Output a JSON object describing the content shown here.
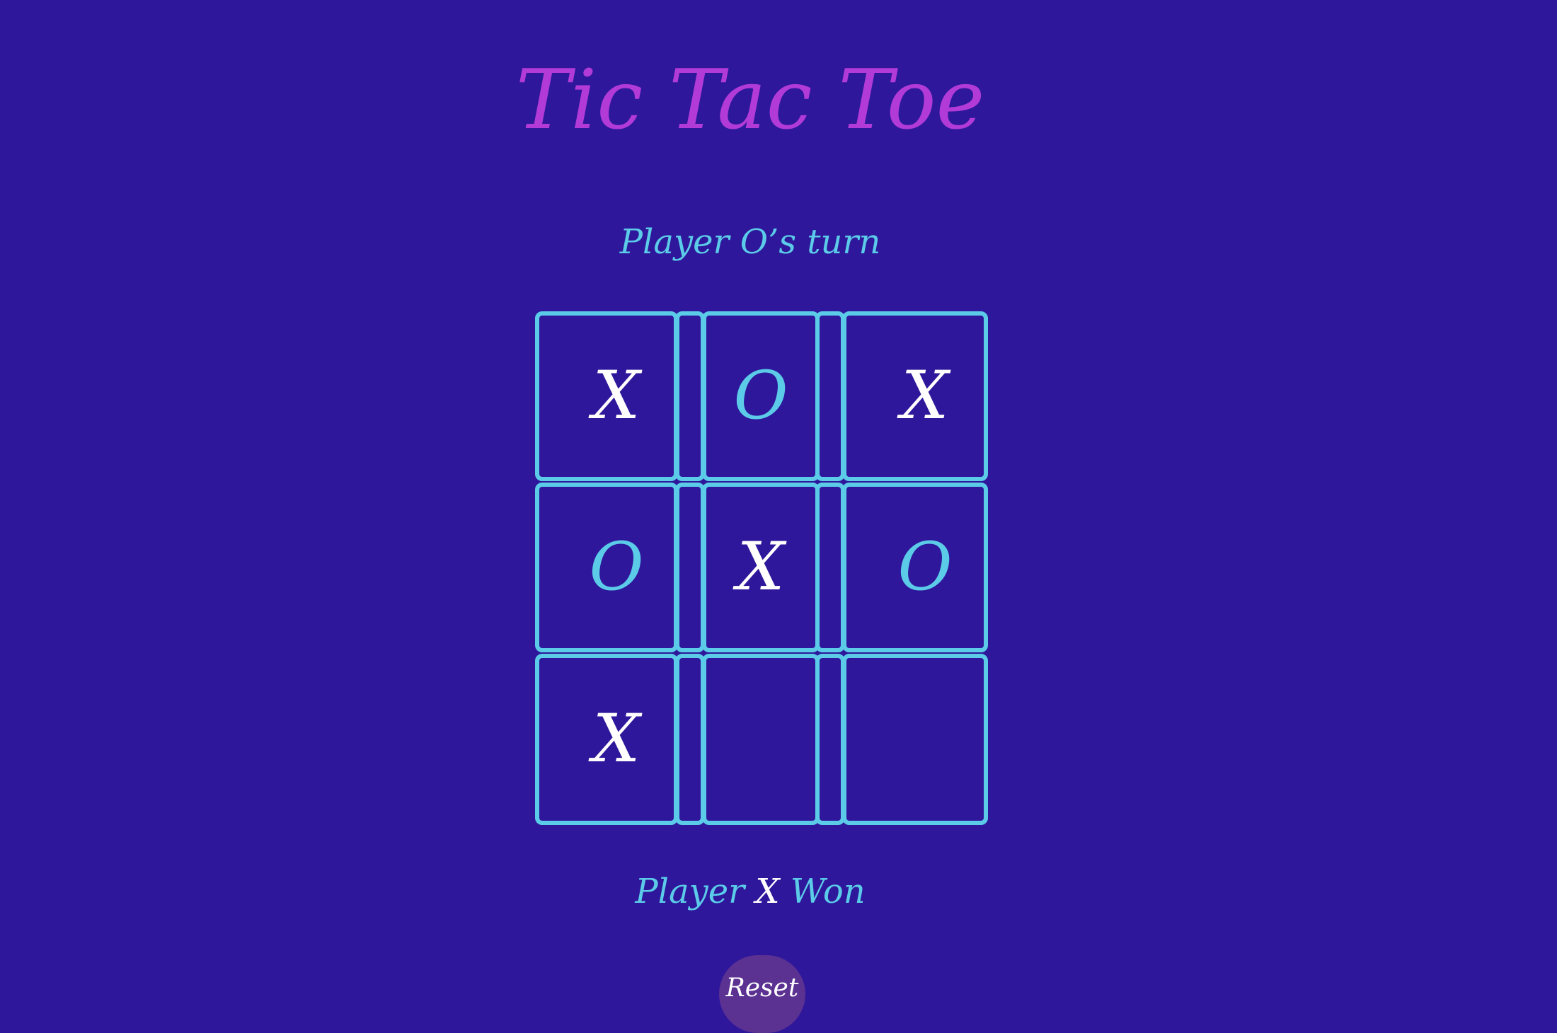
{
  "page": {
    "title": "Tic Tac Toe",
    "turn_text": "Player O’s turn"
  },
  "board": {
    "cells": [
      "X",
      "O",
      "X",
      "O",
      "X",
      "O",
      "X",
      "",
      ""
    ]
  },
  "status": {
    "prefix": "Player",
    "winner": "X",
    "suffix": "Won"
  },
  "controls": {
    "reset_label": "Reset"
  },
  "colors": {
    "background": "#2e179b",
    "title": "#b23bd8",
    "accent": "#5ccbe8",
    "x_mark": "#ffffff",
    "o_mark": "#5ccbe8",
    "reset_button": "#5b3192"
  }
}
